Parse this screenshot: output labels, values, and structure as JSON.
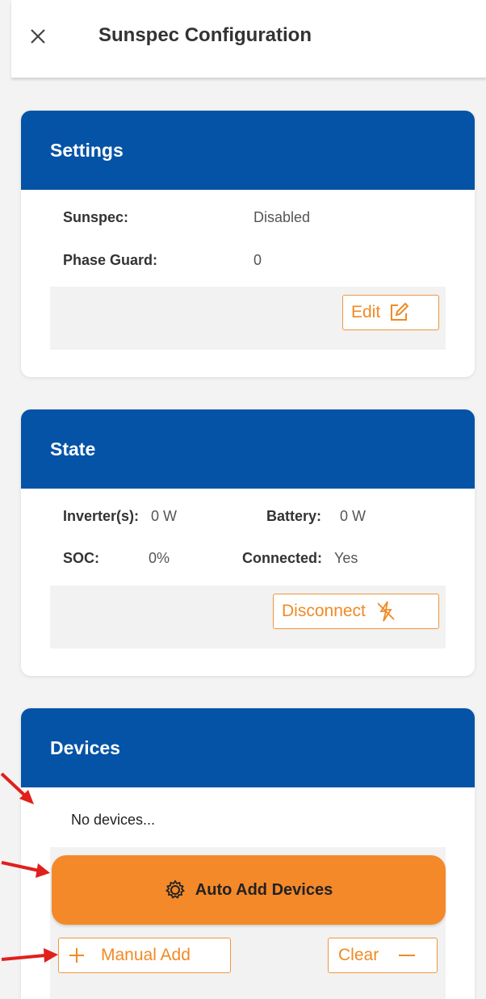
{
  "header": {
    "title": "Sunspec Configuration",
    "close_icon": "close-icon"
  },
  "settings": {
    "title": "Settings",
    "rows": [
      {
        "label": "Sunspec:",
        "value": "Disabled"
      },
      {
        "label": "Phase Guard:",
        "value": "0"
      }
    ],
    "edit_label": "Edit"
  },
  "state": {
    "title": "State",
    "inverter_label": "Inverter(s):",
    "inverter_value": "0 W",
    "battery_label": "Battery:",
    "battery_value": "0 W",
    "soc_label": "SOC:",
    "soc_value": "0%",
    "connected_label": "Connected:",
    "connected_value": "Yes",
    "disconnect_label": "Disconnect"
  },
  "devices": {
    "title": "Devices",
    "empty_text": "No devices...",
    "auto_add_label": "Auto Add Devices",
    "manual_add_label": "Manual Add",
    "clear_label": "Clear"
  },
  "colors": {
    "header_blue": "#0453a6",
    "accent_orange": "#f4892a",
    "annotation_red": "#e0201c"
  }
}
